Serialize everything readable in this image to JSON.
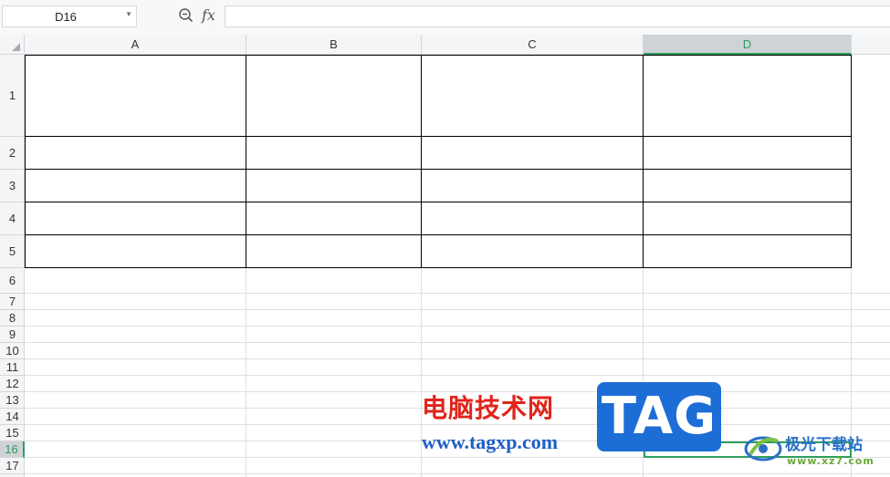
{
  "name_box": {
    "value": "D16"
  },
  "formula_bar": {
    "fx_label": "fx",
    "value": ""
  },
  "columns": [
    "A",
    "B",
    "C",
    "D"
  ],
  "selected_column": "D",
  "rows": [
    "1",
    "2",
    "3",
    "4",
    "5",
    "6",
    "7",
    "8",
    "9",
    "10",
    "11",
    "12",
    "13",
    "14",
    "15",
    "16",
    "17"
  ],
  "selected_row": "16",
  "colors": {
    "selection": "#2e9e5d",
    "header_bg": "#f4f5f6",
    "gridline": "#dde0e3"
  },
  "watermark": {
    "site_name": "电脑技术网",
    "site_url": "www.tagxp.com",
    "badge": "TAG",
    "brand_name": "极光下载站",
    "brand_url": "www.xz7.com"
  }
}
